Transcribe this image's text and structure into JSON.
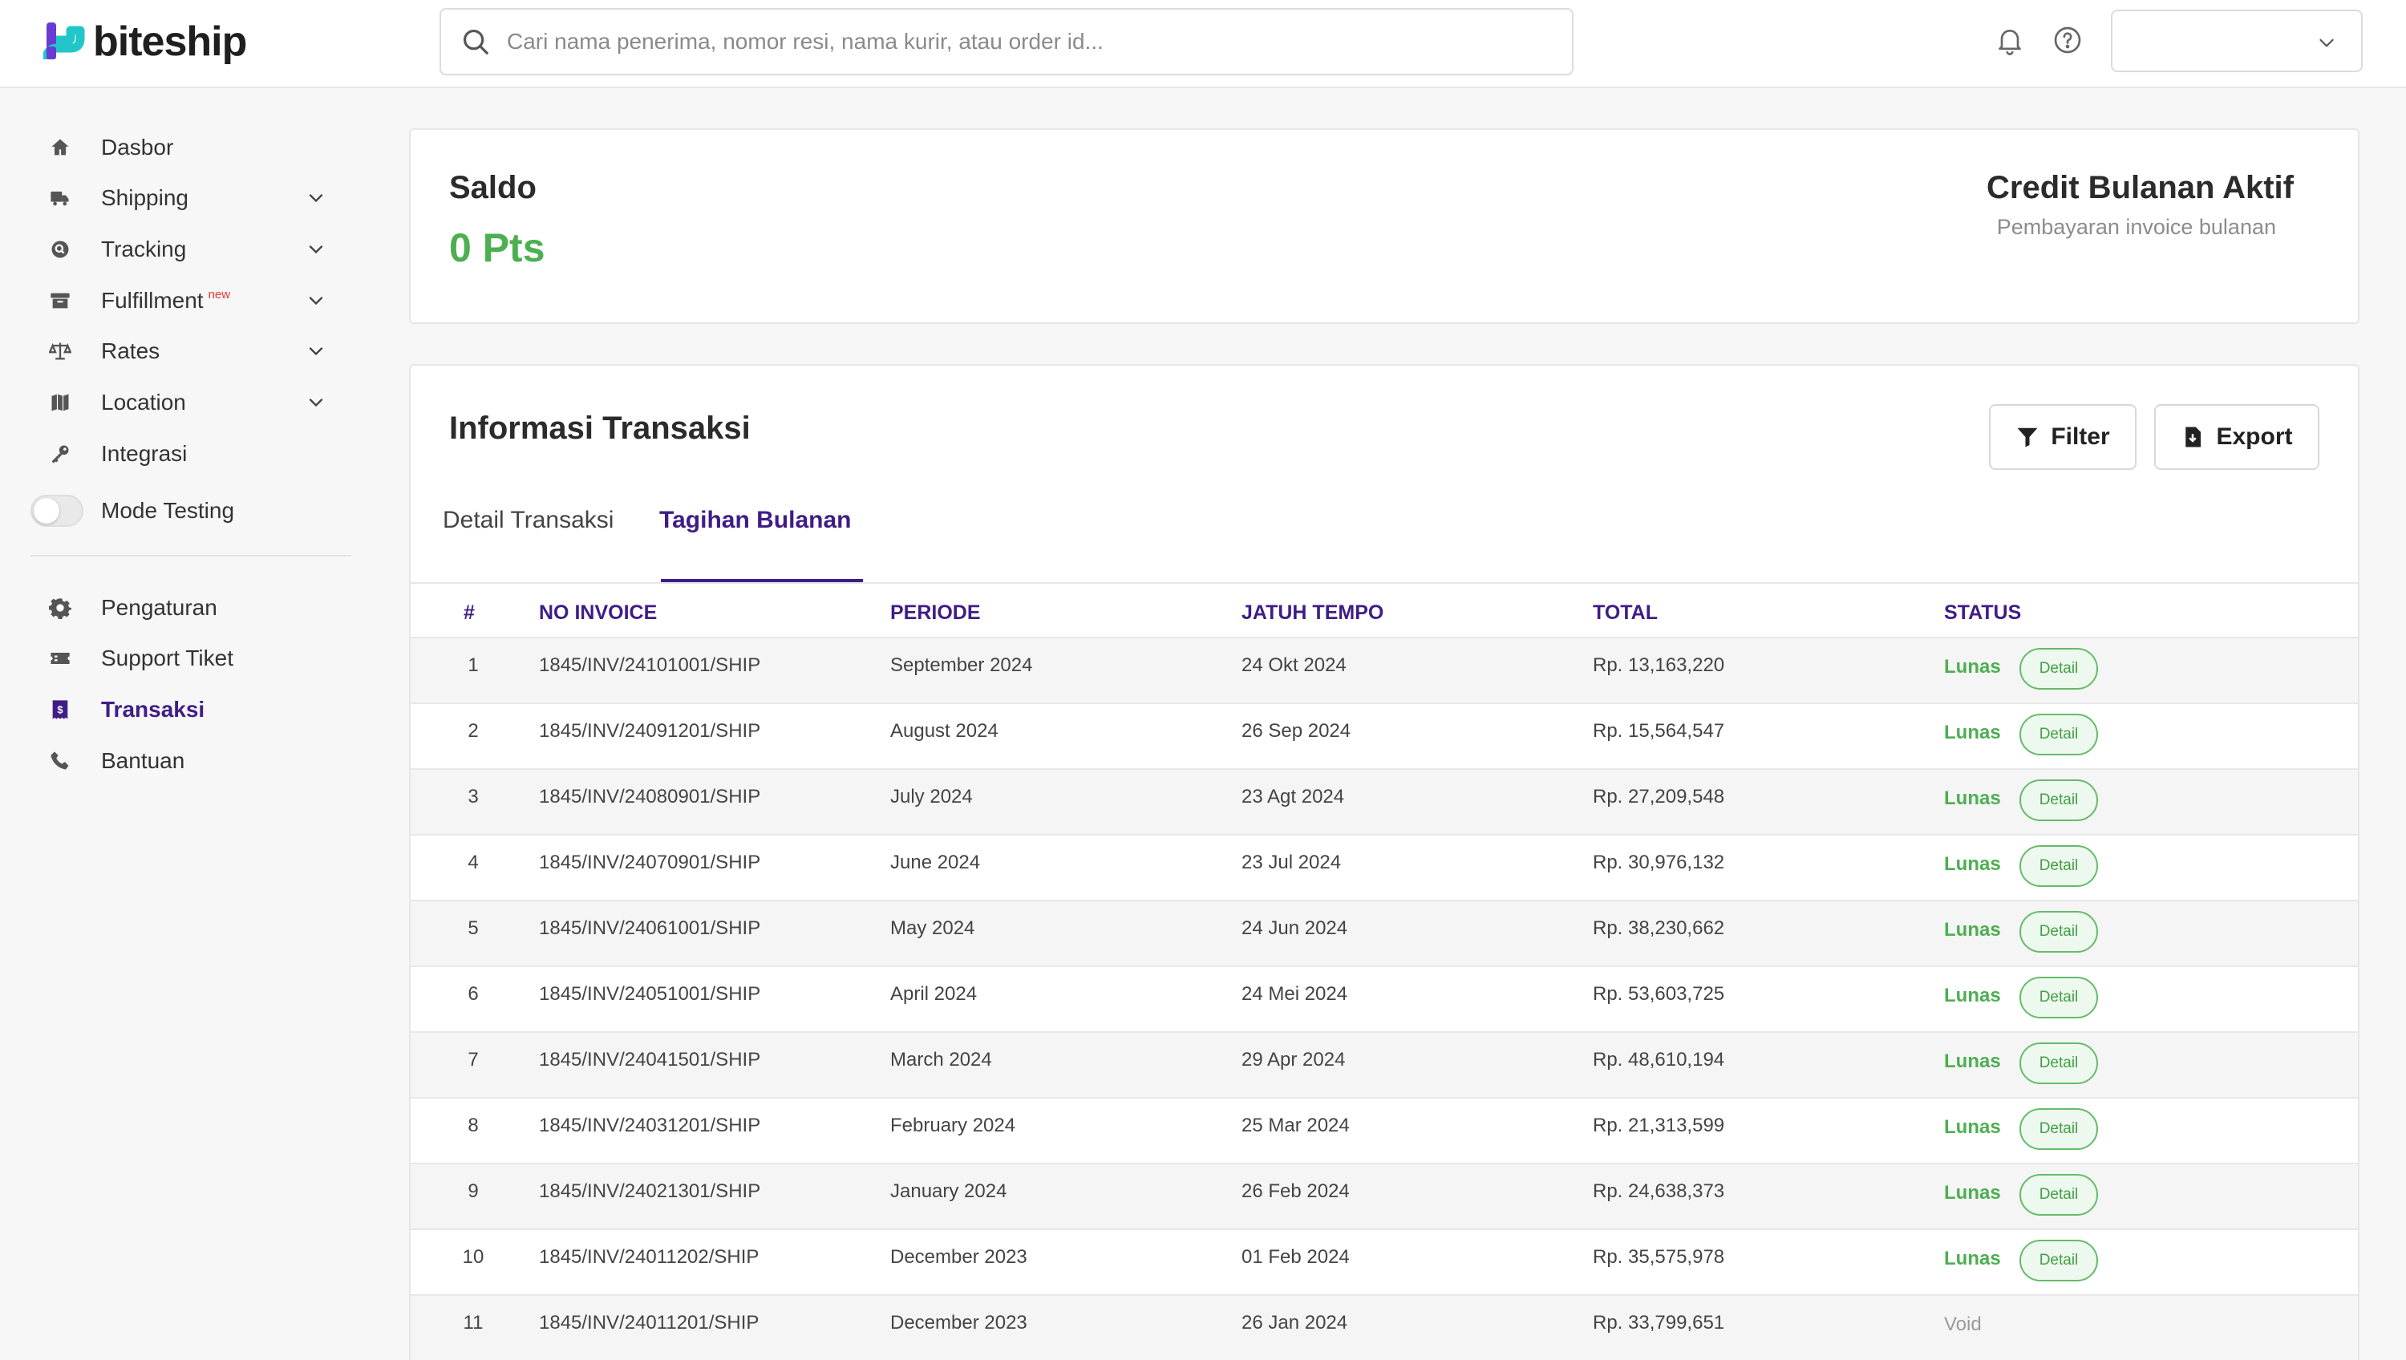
{
  "brand": {
    "name": "biteship",
    "accent": "#3f1d86",
    "logo_colors": [
      "#6a3ad4",
      "#23c6c8"
    ]
  },
  "search": {
    "placeholder": "Cari nama penerima, nomor resi, nama kurir, atau order id...",
    "icon": "search-icon"
  },
  "topbar": {
    "icons": [
      "bell-icon",
      "help-icon"
    ],
    "user_select_value": ""
  },
  "sidebar": {
    "items": [
      {
        "label": "Dasbor",
        "icon": "home-icon",
        "has_dropdown": false
      },
      {
        "label": "Shipping",
        "icon": "truck-icon",
        "has_dropdown": true
      },
      {
        "label": "Tracking",
        "icon": "tracking-icon",
        "has_dropdown": true
      },
      {
        "label": "Fulfillment",
        "badge": "new",
        "icon": "archive-icon",
        "has_dropdown": true
      },
      {
        "label": "Rates",
        "icon": "scale-icon",
        "has_dropdown": true
      },
      {
        "label": "Location",
        "icon": "map-icon",
        "has_dropdown": true
      },
      {
        "label": "Integrasi",
        "icon": "key-icon",
        "has_dropdown": false
      }
    ],
    "mode_testing": {
      "label": "Mode Testing",
      "enabled": false
    },
    "items_bottom": [
      {
        "label": "Pengaturan",
        "icon": "gear-icon"
      },
      {
        "label": "Support Tiket",
        "icon": "ticket-icon"
      },
      {
        "label": "Transaksi",
        "icon": "receipt-icon",
        "active": true
      },
      {
        "label": "Bantuan",
        "icon": "phone-icon"
      }
    ]
  },
  "saldo": {
    "title": "Saldo",
    "value": "0 Pts",
    "credit_title": "Credit Bulanan Aktif",
    "credit_subtitle": "Pembayaran invoice bulanan"
  },
  "transactions": {
    "title": "Informasi Transaksi",
    "filter_label": "Filter",
    "export_label": "Export",
    "tabs": [
      "Detail Transaksi",
      "Tagihan Bulanan"
    ],
    "active_tab": "Tagihan Bulanan",
    "columns": [
      "#",
      "NO INVOICE",
      "PERIODE",
      "JATUH TEMPO",
      "TOTAL",
      "STATUS"
    ],
    "detail_label": "Detail",
    "rows": [
      {
        "num": "1",
        "invoice": "1845/INV/24101001/SHIP",
        "periode": "September 2024",
        "due": "24 Okt 2024",
        "total": "Rp. 13,163,220",
        "status": "Lunas",
        "detail": true
      },
      {
        "num": "2",
        "invoice": "1845/INV/24091201/SHIP",
        "periode": "August 2024",
        "due": "26 Sep 2024",
        "total": "Rp. 15,564,547",
        "status": "Lunas",
        "detail": true
      },
      {
        "num": "3",
        "invoice": "1845/INV/24080901/SHIP",
        "periode": "July 2024",
        "due": "23 Agt 2024",
        "total": "Rp. 27,209,548",
        "status": "Lunas",
        "detail": true
      },
      {
        "num": "4",
        "invoice": "1845/INV/24070901/SHIP",
        "periode": "June 2024",
        "due": "23 Jul 2024",
        "total": "Rp. 30,976,132",
        "status": "Lunas",
        "detail": true
      },
      {
        "num": "5",
        "invoice": "1845/INV/24061001/SHIP",
        "periode": "May 2024",
        "due": "24 Jun 2024",
        "total": "Rp. 38,230,662",
        "status": "Lunas",
        "detail": true
      },
      {
        "num": "6",
        "invoice": "1845/INV/24051001/SHIP",
        "periode": "April 2024",
        "due": "24 Mei 2024",
        "total": "Rp. 53,603,725",
        "status": "Lunas",
        "detail": true
      },
      {
        "num": "7",
        "invoice": "1845/INV/24041501/SHIP",
        "periode": "March 2024",
        "due": "29 Apr 2024",
        "total": "Rp. 48,610,194",
        "status": "Lunas",
        "detail": true
      },
      {
        "num": "8",
        "invoice": "1845/INV/24031201/SHIP",
        "periode": "February 2024",
        "due": "25 Mar 2024",
        "total": "Rp. 21,313,599",
        "status": "Lunas",
        "detail": true
      },
      {
        "num": "9",
        "invoice": "1845/INV/24021301/SHIP",
        "periode": "January 2024",
        "due": "26 Feb 2024",
        "total": "Rp. 24,638,373",
        "status": "Lunas",
        "detail": true
      },
      {
        "num": "10",
        "invoice": "1845/INV/24011202/SHIP",
        "periode": "December 2023",
        "due": "01 Feb 2024",
        "total": "Rp. 35,575,978",
        "status": "Lunas",
        "detail": true
      },
      {
        "num": "11",
        "invoice": "1845/INV/24011201/SHIP",
        "periode": "December 2023",
        "due": "26 Jan 2024",
        "total": "Rp. 33,799,651",
        "status": "Void",
        "detail": false
      }
    ]
  }
}
